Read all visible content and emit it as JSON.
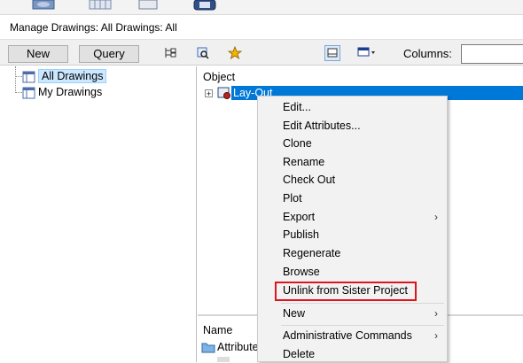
{
  "window": {
    "title": "Manage Drawings: All Drawings: All"
  },
  "toolbar": {
    "new_label": "New",
    "query_label": "Query",
    "columns_label": "Columns:",
    "columns_value": ""
  },
  "tree": {
    "items": [
      {
        "label": "All Drawings",
        "selected": true
      },
      {
        "label": "My Drawings",
        "selected": false
      }
    ]
  },
  "object_panel": {
    "header": "Object",
    "row_label": "Lay-Out"
  },
  "bottom_panel": {
    "header": "Name",
    "row_label": "Attribute"
  },
  "context_menu": {
    "items": [
      {
        "label": "Edit...",
        "submenu": false
      },
      {
        "label": "Edit Attributes...",
        "submenu": false
      },
      {
        "label": "Clone",
        "submenu": false
      },
      {
        "label": "Rename",
        "submenu": false
      },
      {
        "label": "Check Out",
        "submenu": false
      },
      {
        "label": "Plot",
        "submenu": false
      },
      {
        "label": "Export",
        "submenu": true
      },
      {
        "label": "Publish",
        "submenu": false
      },
      {
        "label": "Regenerate",
        "submenu": false
      },
      {
        "label": "Browse",
        "submenu": false
      },
      {
        "label": "Unlink from Sister Project",
        "submenu": false,
        "highlighted": true
      },
      {
        "label": "New",
        "submenu": true
      },
      {
        "label": "Administrative Commands",
        "submenu": true
      },
      {
        "label": "Delete",
        "submenu": false
      }
    ],
    "submenu_arrow": "›",
    "highlight_color": "#e0141d"
  },
  "icons": {
    "expand": "plus-box-icon",
    "drawing": "drawing-icon",
    "folder": "folder-icon"
  },
  "colors": {
    "selection": "#0078d7",
    "tree_selection": "#cce8ff"
  }
}
